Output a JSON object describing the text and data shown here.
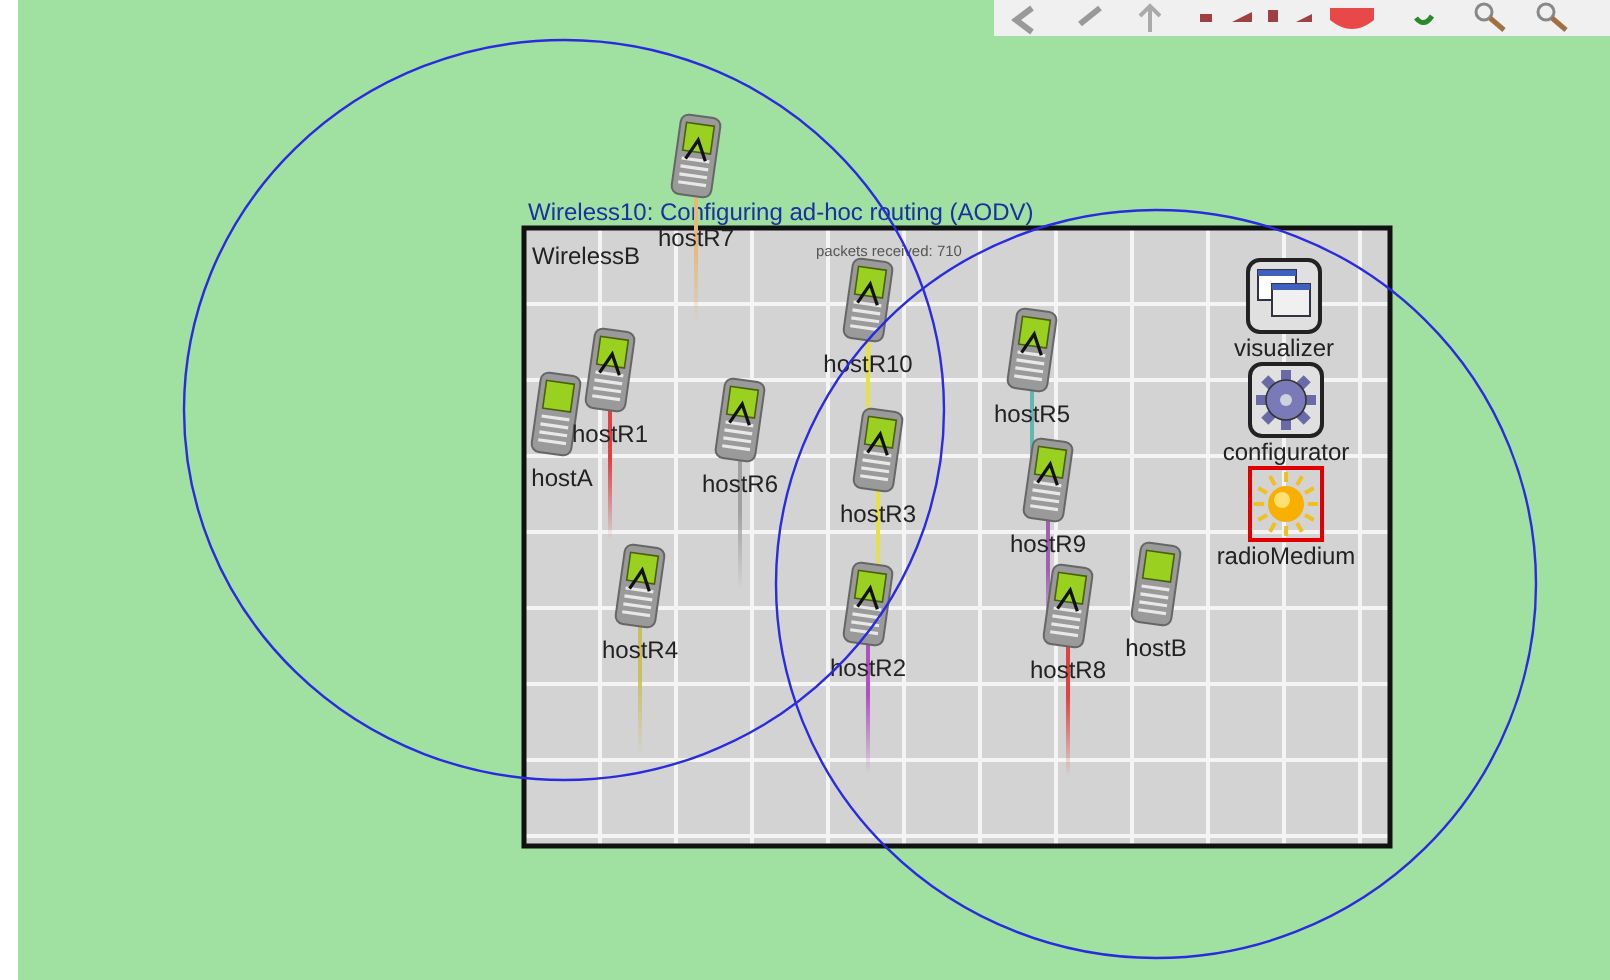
{
  "network": {
    "title": "Wireless10: Configuring ad-hoc routing (AODV)",
    "name": "WirelessB",
    "status": "packets received: 710"
  },
  "hosts": [
    {
      "name": "hostR7",
      "color": "#e8b878"
    },
    {
      "name": "hostR10",
      "color": "#e8e040"
    },
    {
      "name": "hostR1",
      "color": "#e04040"
    },
    {
      "name": "hostA"
    },
    {
      "name": "hostR6",
      "color": "#a0a0a0"
    },
    {
      "name": "hostR5",
      "color": "#60b8b0"
    },
    {
      "name": "hostR3",
      "color": "#e8e040"
    },
    {
      "name": "hostR9",
      "color": "#a060b0"
    },
    {
      "name": "hostR4",
      "color": "#c8c060"
    },
    {
      "name": "hostR2",
      "color": "#b050c0"
    },
    {
      "name": "hostR8",
      "color": "#e04040"
    },
    {
      "name": "hostB"
    }
  ],
  "modules": [
    {
      "name": "visualizer",
      "kind": "visualizer",
      "selected": false
    },
    {
      "name": "configurator",
      "kind": "configurator",
      "selected": false
    },
    {
      "name": "radioMedium",
      "kind": "radio",
      "selected": true
    }
  ]
}
